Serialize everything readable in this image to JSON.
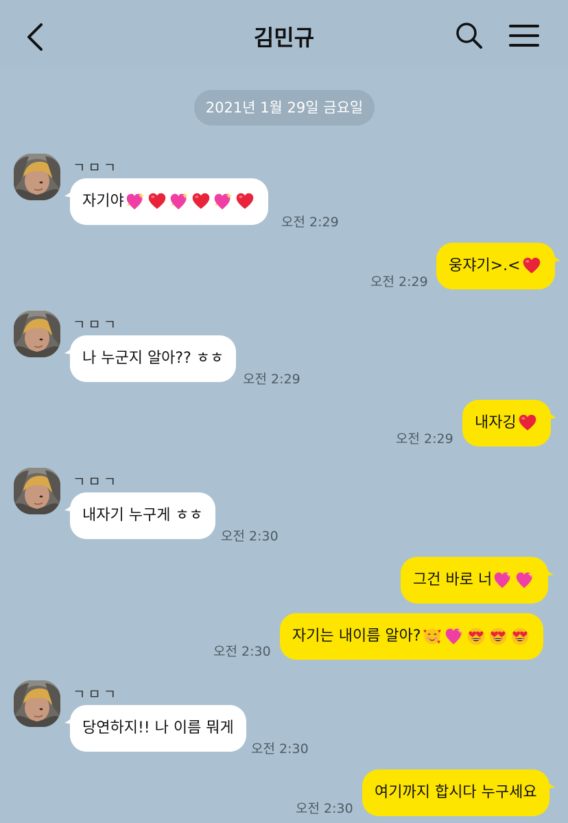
{
  "header": {
    "title": "김민규"
  },
  "date_divider": "2021년 1월 29일 금요일",
  "messages": [
    {
      "sender": "ㄱㅁㄱ",
      "text": "자기야",
      "time": "오전 2:29"
    },
    {
      "text": "웅쟈기>.<",
      "time": "오전 2:29"
    },
    {
      "sender": "ㄱㅁㄱ",
      "text": "나 누군지 알아?? ㅎㅎ",
      "time": "오전 2:29"
    },
    {
      "text": "내자깅",
      "time": "오전 2:29"
    },
    {
      "sender": "ㄱㅁㄱ",
      "text": "내자기 누구게 ㅎㅎ",
      "time": "오전 2:30"
    },
    {
      "text": "그건 바로 너"
    },
    {
      "text": "자기는 내이름 알아?",
      "time": "오전 2:30"
    },
    {
      "sender": "ㄱㅁㄱ",
      "text": "당연하지!! 나 이름 뭐게",
      "time": "오전 2:30"
    },
    {
      "text": "여기까지 합시다 누구세요",
      "time": "오전 2:30"
    }
  ],
  "colors": {
    "background": "#abc1d1",
    "my_bubble": "#fde500",
    "their_bubble": "#ffffff"
  },
  "icons": [
    "back-arrow-icon",
    "search-icon",
    "menu-icon",
    "heart-icon",
    "sparkling-heart-icon",
    "smiling-face-with-hearts-icon",
    "heart-eyes-icon"
  ]
}
